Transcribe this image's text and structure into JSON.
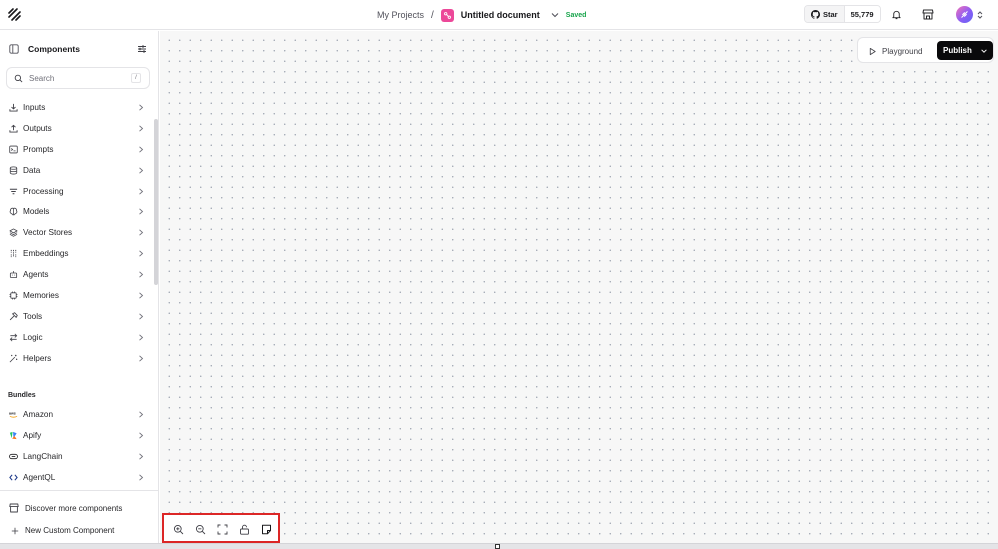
{
  "header": {
    "projects_label": "My Projects",
    "separator": "/",
    "document_name": "Untitled document",
    "save_status": "Saved",
    "github": {
      "star_label": "Star",
      "star_count": "55,779"
    }
  },
  "sidebar": {
    "title": "Components",
    "search": {
      "placeholder": "Search",
      "shortcut": "/"
    },
    "categories": [
      {
        "label": "Inputs",
        "icon": "download-icon"
      },
      {
        "label": "Outputs",
        "icon": "upload-icon"
      },
      {
        "label": "Prompts",
        "icon": "terminal-icon"
      },
      {
        "label": "Data",
        "icon": "database-icon"
      },
      {
        "label": "Processing",
        "icon": "list-filter-icon"
      },
      {
        "label": "Models",
        "icon": "brain-icon"
      },
      {
        "label": "Vector Stores",
        "icon": "layers-icon"
      },
      {
        "label": "Embeddings",
        "icon": "binary-icon"
      },
      {
        "label": "Agents",
        "icon": "bot-icon"
      },
      {
        "label": "Memories",
        "icon": "cpu-icon"
      },
      {
        "label": "Tools",
        "icon": "hammer-icon"
      },
      {
        "label": "Logic",
        "icon": "arrows-icon"
      },
      {
        "label": "Helpers",
        "icon": "wand-icon"
      }
    ],
    "bundles_title": "Bundles",
    "bundles": [
      {
        "label": "Amazon",
        "icon": "amazon-icon"
      },
      {
        "label": "Apify",
        "icon": "apify-icon"
      },
      {
        "label": "LangChain",
        "icon": "langchain-icon"
      },
      {
        "label": "AgentQL",
        "icon": "agentql-icon"
      }
    ],
    "footer": {
      "discover_label": "Discover more components",
      "custom_label": "New Custom Component"
    }
  },
  "canvas": {
    "playground_label": "Playground",
    "publish_label": "Publish",
    "controls": [
      "zoom-in-icon",
      "zoom-out-icon",
      "fit-view-icon",
      "lock-icon",
      "note-icon"
    ]
  },
  "colors": {
    "accent_pink": "#ec4899",
    "saved_green": "#16a34a",
    "publish_bg": "#09090b",
    "highlight_red": "#dc2626"
  }
}
